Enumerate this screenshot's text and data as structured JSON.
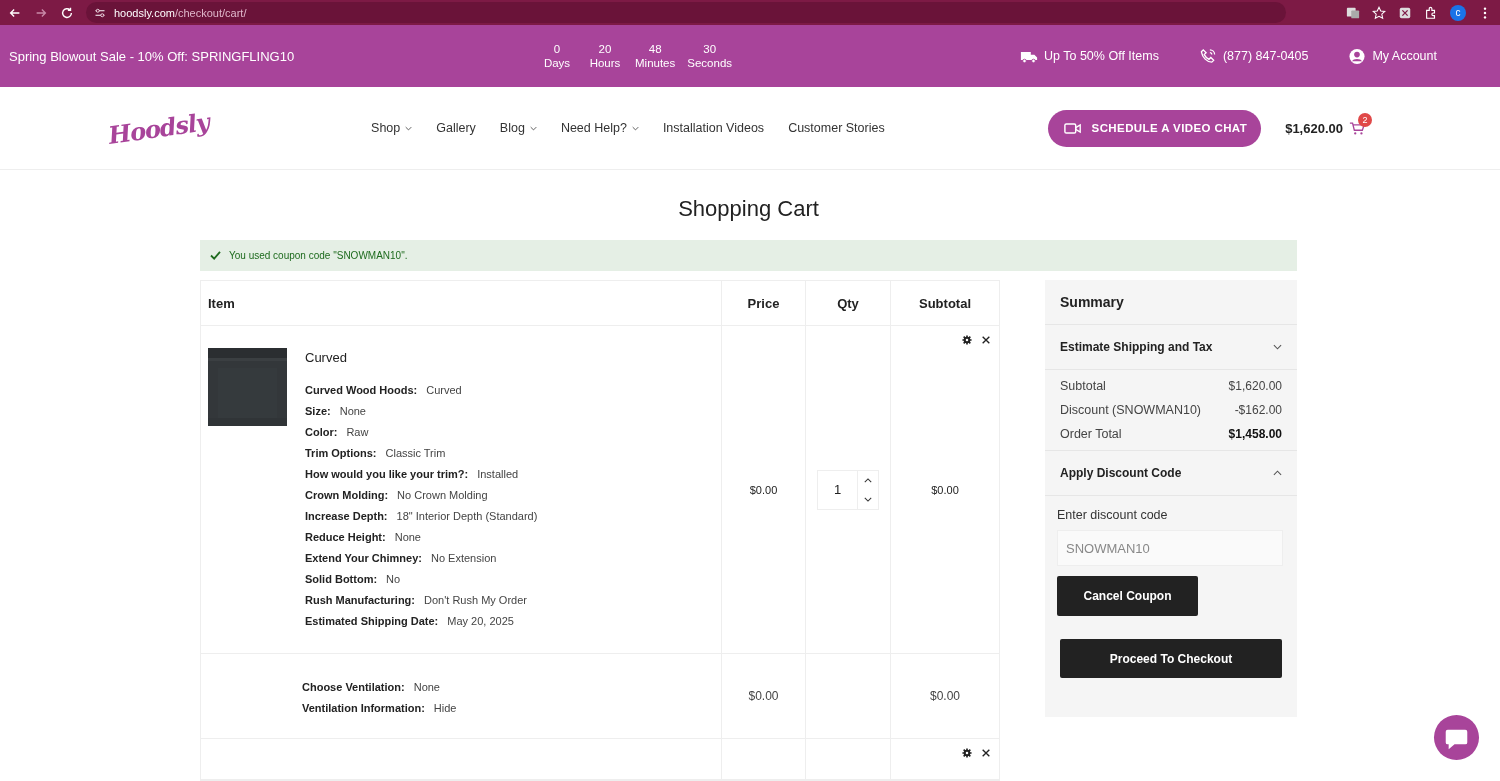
{
  "browser": {
    "url_host": "hoodsly.com",
    "url_path": "/checkout/cart/",
    "profile": "c"
  },
  "promo_bar": {
    "sale": "Spring Blowout Sale - 10% Off: SPRINGFLING10",
    "countdown": [
      {
        "value": "0",
        "unit": "Days"
      },
      {
        "value": "20",
        "unit": "Hours"
      },
      {
        "value": "48",
        "unit": "Minutes"
      },
      {
        "value": "30",
        "unit": "Seconds"
      }
    ],
    "links": [
      {
        "kind": "truck",
        "label": "Up To 50% Off Items"
      },
      {
        "kind": "phone",
        "label": "(877) 847-0405"
      },
      {
        "kind": "account",
        "label": "My Account"
      }
    ]
  },
  "header": {
    "logo": "Hoodsly",
    "nav": [
      {
        "label": "Shop",
        "dropdown": true
      },
      {
        "label": "Gallery",
        "dropdown": false
      },
      {
        "label": "Blog",
        "dropdown": true
      },
      {
        "label": "Need Help?",
        "dropdown": true
      },
      {
        "label": "Installation Videos",
        "dropdown": false
      },
      {
        "label": "Customer Stories",
        "dropdown": false
      }
    ],
    "video_button": "SCHEDULE A VIDEO CHAT",
    "cart_total": "$1,620.00",
    "cart_count": "2"
  },
  "title": "Shopping Cart",
  "notice": "You used coupon code \"SNOWMAN10\".",
  "table": {
    "columns": [
      "Item",
      "Price",
      "Qty",
      "Subtotal"
    ],
    "rows": [
      {
        "kind": "product",
        "name": "Curved",
        "options": [
          {
            "label": "Curved Wood Hoods:",
            "value": "Curved"
          },
          {
            "label": "Size:",
            "value": "None"
          },
          {
            "label": "Color:",
            "value": "Raw"
          },
          {
            "label": "Trim Options:",
            "value": "Classic Trim"
          },
          {
            "label": "How would you like your trim?:",
            "value": "Installed"
          },
          {
            "label": "Crown Molding:",
            "value": "No Crown Molding"
          },
          {
            "label": "Increase Depth:",
            "value": "18\" Interior Depth (Standard)"
          },
          {
            "label": "Reduce Height:",
            "value": "None"
          },
          {
            "label": "Extend Your Chimney:",
            "value": "No Extension"
          },
          {
            "label": "Solid Bottom:",
            "value": "No"
          },
          {
            "label": "Rush Manufacturing:",
            "value": "Don't Rush My Order"
          },
          {
            "label": "Estimated Shipping Date:",
            "value": "May 20, 2025"
          }
        ],
        "price": "$0.00",
        "qty": "1",
        "subtotal": "$0.00"
      },
      {
        "kind": "addon",
        "options": [
          {
            "label": "Choose Ventilation:",
            "value": "None"
          },
          {
            "label": "Ventilation Information:",
            "value": "Hide"
          }
        ],
        "price": "$0.00",
        "subtotal": "$0.00"
      },
      {
        "kind": "partial"
      }
    ]
  },
  "summary": {
    "title": "Summary",
    "shipping": {
      "label": "Estimate Shipping and Tax",
      "expanded": false
    },
    "lines": [
      {
        "label": "Subtotal",
        "value": "$1,620.00",
        "total": false
      },
      {
        "label": "Discount (SNOWMAN10)",
        "value": "-$162.00",
        "total": false
      },
      {
        "label": "Order Total",
        "value": "$1,458.00",
        "total": true
      }
    ],
    "discount": {
      "label": "Apply Discount Code",
      "expanded": true,
      "field_label": "Enter discount code",
      "value": "SNOWMAN10",
      "button": "Cancel Coupon"
    },
    "checkout": "Proceed To Checkout"
  }
}
